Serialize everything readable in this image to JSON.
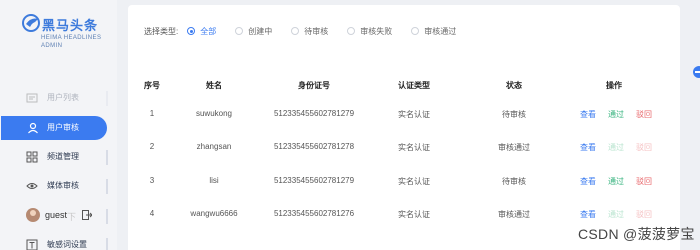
{
  "brand": {
    "title": "黑马头条",
    "subtitle_line1": "HEIMA HEADLINES",
    "subtitle_line2": "ADMIN"
  },
  "sidebar": {
    "items": [
      {
        "label": "用户列表",
        "icon": "user-list-icon",
        "state": "faded"
      },
      {
        "label": "用户审核",
        "icon": "user-audit-icon",
        "state": "active"
      },
      {
        "label": "频道管理",
        "icon": "grid-icon",
        "state": "normal"
      },
      {
        "label": "媒体审核",
        "icon": "media-icon",
        "state": "normal"
      },
      {
        "label": "敏感词设置",
        "icon": "text-icon",
        "state": "normal"
      }
    ],
    "user": {
      "name": "guest",
      "ghost_text": "下"
    }
  },
  "filter": {
    "label": "选择类型:",
    "options": [
      {
        "label": "全部",
        "checked": true
      },
      {
        "label": "创建中",
        "checked": false
      },
      {
        "label": "待审核",
        "checked": false
      },
      {
        "label": "审核失败",
        "checked": false
      },
      {
        "label": "审核通过",
        "checked": false
      }
    ]
  },
  "table": {
    "headers": [
      "序号",
      "姓名",
      "身份证号",
      "认证类型",
      "状态",
      "操作"
    ],
    "rows": [
      {
        "index": "1",
        "name": "suwukong",
        "id_number": "512335455602781279",
        "type": "实名认证",
        "status": "待审核",
        "pending": true
      },
      {
        "index": "2",
        "name": "zhangsan",
        "id_number": "512335455602781278",
        "type": "实名认证",
        "status": "审核通过",
        "pending": false
      },
      {
        "index": "3",
        "name": "lisi",
        "id_number": "512335455602781279",
        "type": "实名认证",
        "status": "待审核",
        "pending": true
      },
      {
        "index": "4",
        "name": "wangwu6666",
        "id_number": "512335455602781276",
        "type": "实名认证",
        "status": "审核通过",
        "pending": false
      }
    ],
    "actions": {
      "view": "查看",
      "pass": "通过",
      "reject": "驳回"
    }
  },
  "watermark": "CSDN @菠菠萝宝",
  "colors": {
    "accent": "#3b7bf0",
    "pass": "#36b37e",
    "reject": "#e8666a",
    "sidebar_bg": "#f3f4f7"
  }
}
